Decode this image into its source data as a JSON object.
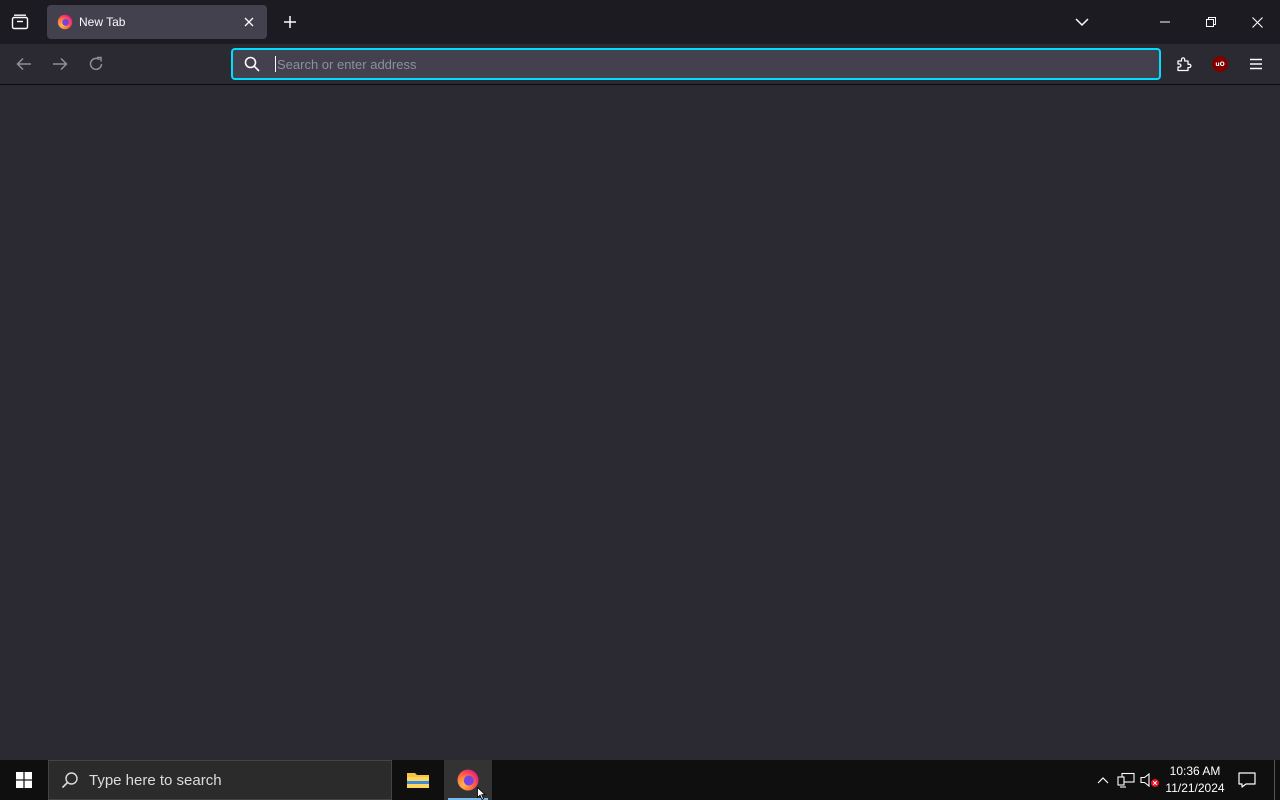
{
  "browser": {
    "tab": {
      "title": "New Tab"
    },
    "urlbar": {
      "placeholder": "Search or enter address",
      "value": ""
    },
    "accent": "#00ddff",
    "background": "#2b2a33"
  },
  "taskbar": {
    "search_placeholder": "Type here to search",
    "clock": {
      "time": "10:36 AM",
      "date": "11/21/2024"
    }
  }
}
